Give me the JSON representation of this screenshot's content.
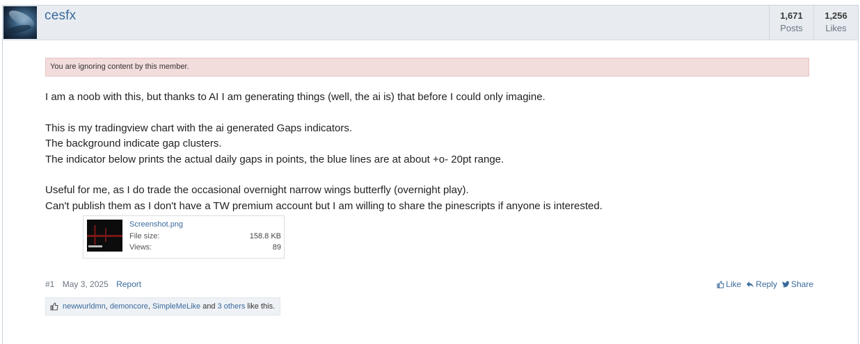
{
  "user": {
    "name": "cesfx",
    "posts_count": "1,671",
    "posts_label": "Posts",
    "likes_count": "1,256",
    "likes_label": "Likes"
  },
  "notice": "You are ignoring content by this member.",
  "message": {
    "lines": [
      "I am a noob with this, but thanks to AI I am generating things (well, the ai is) that before I could only imagine.",
      "This is my tradingview chart with the ai generated Gaps indicators.",
      "The background indicate gap clusters.",
      "The indicator below prints the actual daily gaps in points, the blue lines are at about +o- 20pt range.",
      "Useful for me, as I do trade the occasional overnight narrow wings butterfly (overnight play).",
      "Can't publish them as I don't have a TW premium account but I am willing to share the pinescripts if anyone is interested."
    ]
  },
  "attachment": {
    "filename": "Screenshot.png",
    "size_label": "File size:",
    "size_value": "158.8 KB",
    "views_label": "Views:",
    "views_value": "89"
  },
  "meta": {
    "post_number": "#1",
    "date": "May 3, 2025",
    "report": "Report"
  },
  "actions": {
    "like": "Like",
    "reply": "Reply",
    "share": "Share"
  },
  "likes": {
    "users": [
      "newwurldmn",
      "demoncore",
      "SimpleMeLike"
    ],
    "sep1": ", ",
    "sep2": ", ",
    "and": " and ",
    "others": "3 others",
    "suffix": " like this."
  },
  "colors": {
    "link": "#3a6a9c",
    "notice_bg": "#f3dcdc",
    "user_bar_bg": "#e8ecf1"
  }
}
